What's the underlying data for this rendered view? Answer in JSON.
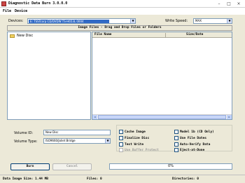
{
  "window": {
    "title": "Diagnostic Data Burn 3.0.0.0",
    "minimize": "–",
    "maximize": "□",
    "close": "×"
  },
  "menu": {
    "items": [
      "File",
      "Device"
    ]
  },
  "devices": {
    "label": "Devices:",
    "selected": "E: TSSTcorp CD/DVDW TS-H653L 0004"
  },
  "write_speed": {
    "label": "Write Speed:",
    "selected": "MAX"
  },
  "hint": "Image Files - Drag and Drop Files or Folders",
  "tree": {
    "items": [
      "New Disc"
    ]
  },
  "file_list": {
    "columns": [
      "File Name",
      "Size/Date"
    ]
  },
  "volume": {
    "id_label": "Volume ID:",
    "id_value": "New Disc",
    "type_label": "Volume Type:",
    "type_value": "ISO9660/Joliet Bridge"
  },
  "options": [
    {
      "label": "Cache Image",
      "enabled": true
    },
    {
      "label": "Finalize Disc",
      "enabled": true
    },
    {
      "label": "Test Write",
      "enabled": true
    },
    {
      "label": "Use Buffer Protect",
      "enabled": false
    },
    {
      "label": "Model 1b (CD Only)",
      "enabled": true
    },
    {
      "label": "Use File Dates",
      "enabled": true
    },
    {
      "label": "Auto-Verify Data",
      "enabled": true
    },
    {
      "label": "Eject-at-Done",
      "enabled": true
    }
  ],
  "buttons": {
    "burn": "Burn",
    "cancel": "Cancel"
  },
  "progress": {
    "text": "0%",
    "value": 0
  },
  "status": {
    "data_image_size": "Data Image Size: 1.44 MB",
    "files": "Files: 0",
    "directories": "Directories: 0"
  },
  "icons": {
    "app": "app-icon",
    "folder": "folder-icon",
    "dropdown": "chevron-down-icon"
  }
}
